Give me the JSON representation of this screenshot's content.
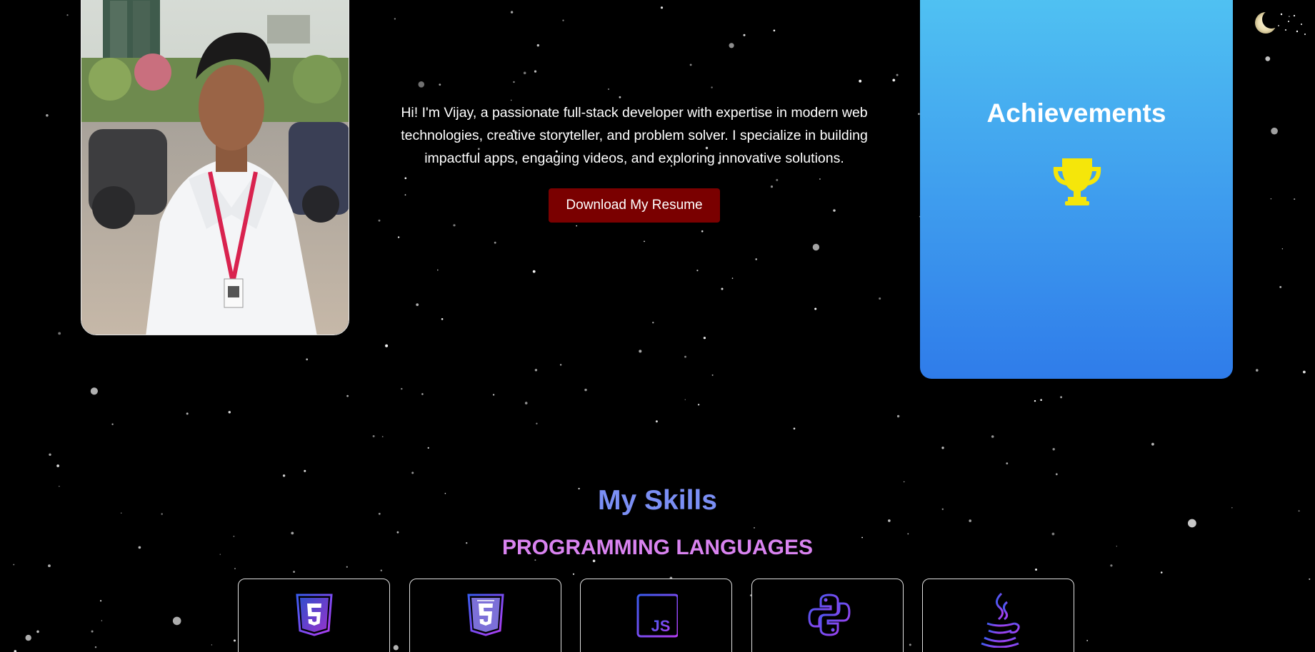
{
  "intro": {
    "text": "Hi! I'm Vijay, a passionate full-stack developer with expertise in modern web technologies, creative storyteller, and problem solver. I specialize in building impactful apps, engaging videos, and exploring innovative solutions.",
    "resume_button": "Download My Resume"
  },
  "achievements": {
    "title": "Achievements",
    "icon": "trophy-icon"
  },
  "skills": {
    "title": "My Skills",
    "subtitle": "PROGRAMMING LANGUAGES",
    "items": [
      {
        "icon": "html5-icon"
      },
      {
        "icon": "css3-icon"
      },
      {
        "icon": "javascript-icon"
      },
      {
        "icon": "python-icon"
      },
      {
        "icon": "java-icon"
      }
    ]
  },
  "theme": {
    "background": "#000000",
    "resume_button": "#7a0000",
    "achievements_gradient_top": "#50c2f2",
    "achievements_gradient_bottom": "#2f7cea",
    "trophy": "#f5e60a",
    "skills_title": "#7b8ff5",
    "skills_subtitle": "#d983f0",
    "icon_gradient_start": "#3a5cf0",
    "icon_gradient_end": "#b23cf0"
  },
  "theme_toggle": {
    "icon": "moon-icon"
  }
}
